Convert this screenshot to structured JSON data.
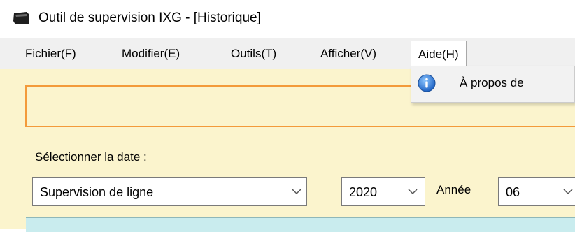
{
  "window": {
    "title": "Outil de supervision IXG - [Historique]",
    "app_icon": "ixg-app-icon"
  },
  "menubar": {
    "items": [
      {
        "label": "Fichier(F)"
      },
      {
        "label": "Modifier(E)"
      },
      {
        "label": "Outils(T)"
      },
      {
        "label": "Afficher(V)"
      },
      {
        "label": "Aide(H)",
        "open": true
      }
    ]
  },
  "dropdown": {
    "items": [
      {
        "label": "À propos de",
        "icon": "info-icon"
      }
    ]
  },
  "form": {
    "date_label": "Sélectionner la date :",
    "type_select": {
      "value": "Supervision de ligne"
    },
    "year_select": {
      "value": "2020"
    },
    "year_label": "Année",
    "month_select": {
      "value": "06"
    }
  },
  "colors": {
    "form_background": "#fbf4cd",
    "highlight_border": "#f39a3a",
    "panel": "#c9ecee",
    "info_blue": "#2f7fd6"
  }
}
